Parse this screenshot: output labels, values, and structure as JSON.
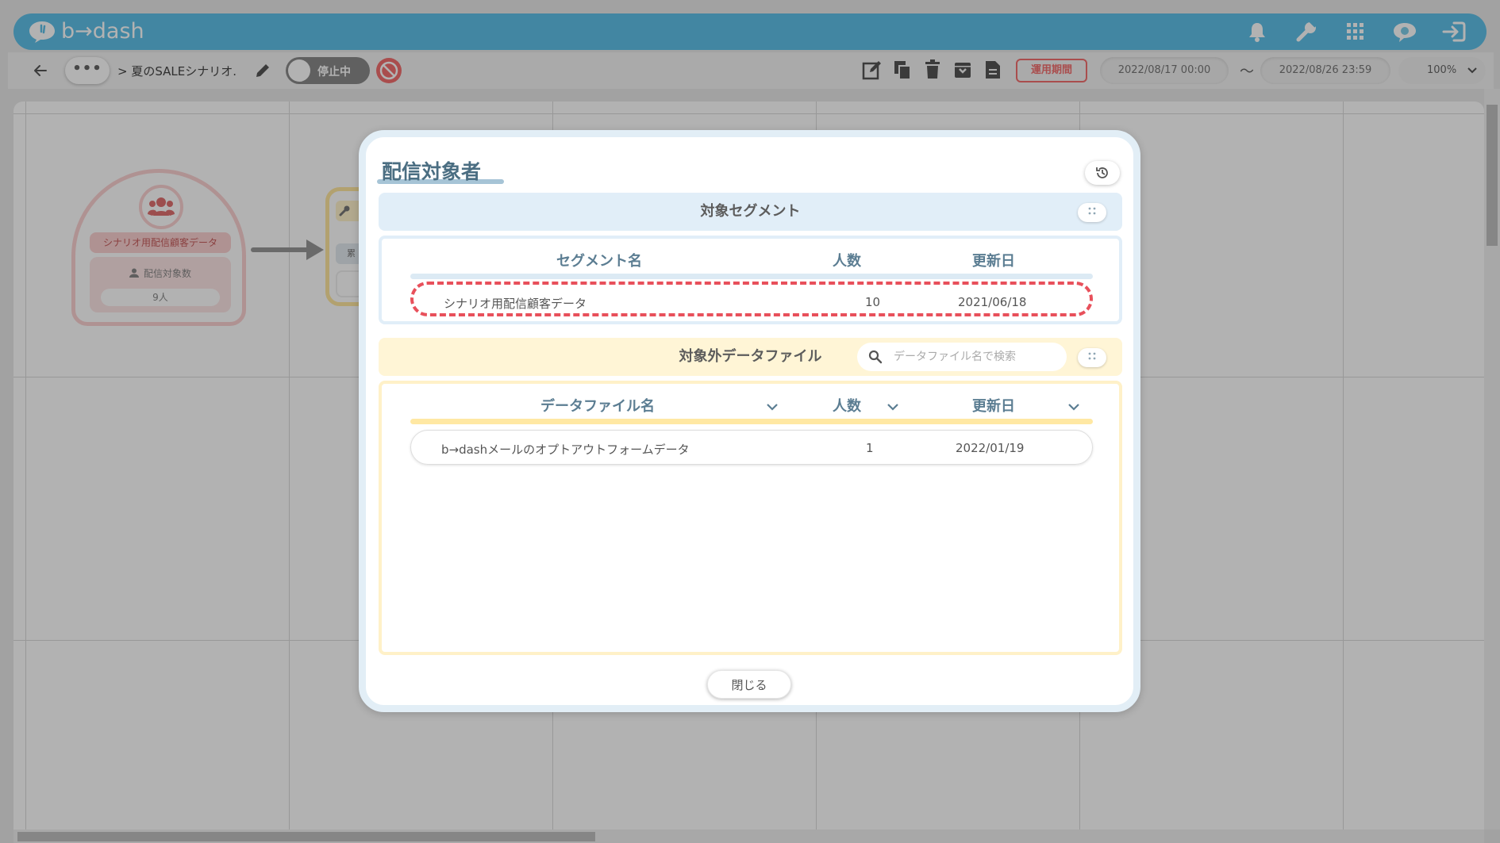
{
  "app": {
    "logo_text": "b→dash"
  },
  "header_icons": [
    "bell-icon",
    "wrench-icon",
    "apps-grid-icon",
    "chat-icon",
    "logout-icon"
  ],
  "toolbar": {
    "more_label": "•••",
    "breadcrumb": "> 夏のSALEシナリオ.",
    "status_toggle_label": "停止中",
    "period_label": "運用期間",
    "start_date": "2022/08/17 00:00",
    "tilde": "〜",
    "end_date": "2022/08/26 23:59",
    "zoom": "100%"
  },
  "canvas": {
    "node_name": "シナリオ用配信顧客データ",
    "node_sub_label": "配信対象数",
    "node_count": "9人",
    "node2_label": "累"
  },
  "modal": {
    "title": "配信対象者",
    "target_segment": {
      "heading": "対象セグメント",
      "columns": [
        "セグメント名",
        "人数",
        "更新日"
      ],
      "rows": [
        {
          "name": "シナリオ用配信顧客データ",
          "count": "10",
          "date": "2021/06/18"
        }
      ]
    },
    "excluded_files": {
      "heading": "対象外データファイル",
      "search_placeholder": "データファイル名で検索",
      "columns": [
        "データファイル名",
        "人数",
        "更新日"
      ],
      "rows": [
        {
          "name": "b→dashメールのオプトアウトフォームデータ",
          "count": "1",
          "date": "2022/01/19"
        }
      ]
    },
    "close_label": "閉じる"
  },
  "colors": {
    "header_blue": "#5fc1e8",
    "alert_red": "#f36f6f",
    "title_text": "#4b6e82",
    "highlight_dash": "#e8505b"
  }
}
